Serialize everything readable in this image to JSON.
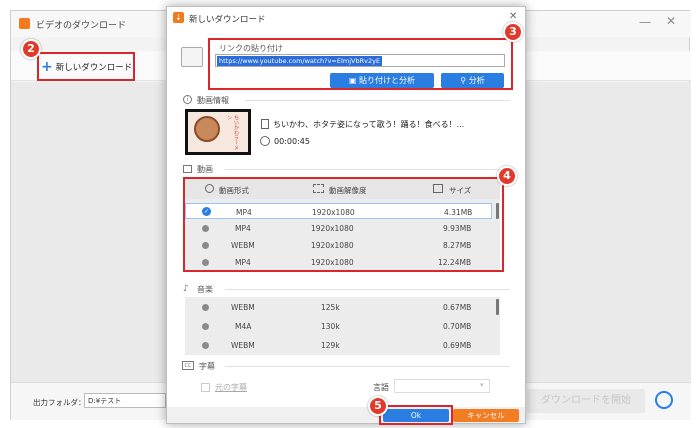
{
  "app": {
    "title": "ビデオのダウンロード",
    "new_download": "新しいダウンロード",
    "output_folder_label": "出力フォルダ：",
    "output_folder_value": "D:¥テスト",
    "start_download": "ダウンロードを開始"
  },
  "dialog": {
    "title": "新しいダウンロード",
    "paste_label": "リンクの貼り付け",
    "url": "https://www.youtube.com/watch?v=EImjVbRv2yE",
    "paste_analyze_button": "貼り付けと分析",
    "analyze_button": "分析",
    "info_section": "動画情報",
    "thumbnail_text": "ちいかわラーメン",
    "video_title": "ちいかわ、ホタテ姿になって歌う！踊る！食べる！...",
    "duration": "00:00:45",
    "video_section": "動画",
    "columns": [
      "動画形式",
      "動画解像度",
      "サイズ"
    ],
    "video_rows": [
      {
        "format": "MP4",
        "resolution": "1920x1080",
        "size": "4.31MB",
        "selected": true
      },
      {
        "format": "MP4",
        "resolution": "1920x1080",
        "size": "9.93MB",
        "selected": false
      },
      {
        "format": "WEBM",
        "resolution": "1920x1080",
        "size": "8.27MB",
        "selected": false
      },
      {
        "format": "MP4",
        "resolution": "1920x1080",
        "size": "12.24MB",
        "selected": false
      }
    ],
    "audio_section": "音楽",
    "audio_rows": [
      {
        "format": "WEBM",
        "bitrate": "125k",
        "size": "0.67MB"
      },
      {
        "format": "M4A",
        "bitrate": "130k",
        "size": "0.70MB"
      },
      {
        "format": "WEBM",
        "bitrate": "129k",
        "size": "0.69MB"
      }
    ],
    "subtitle_section": "字幕",
    "original_subtitle": "元の字幕",
    "language_label": "言語",
    "ok_button": "Ok",
    "cancel_button": "キャンセル"
  },
  "badges": [
    "2",
    "3",
    "4",
    "5"
  ],
  "colors": {
    "accent": "#2a7de1",
    "highlight": "#d9262b",
    "cancel": "#f27d23"
  }
}
